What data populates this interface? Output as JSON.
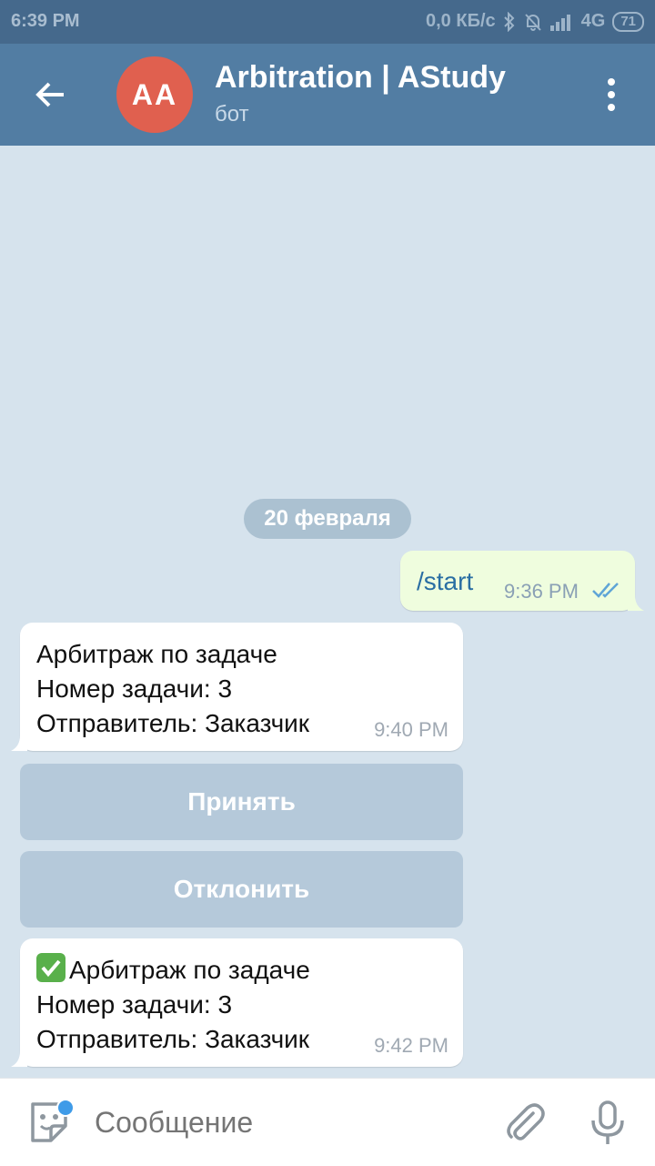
{
  "status_bar": {
    "time": "6:39 PM",
    "speed": "0,0 КБ/с",
    "network": "4G",
    "battery": "71"
  },
  "header": {
    "avatar_initials": "AA",
    "title": "Arbitration | AStudy",
    "subtitle": "бот",
    "icons": [
      "back-arrow-icon",
      "more-vertical-icon"
    ]
  },
  "chat": {
    "date_label": "20 февраля",
    "outgoing": {
      "text": "/start",
      "time": "9:36 PM",
      "status": "read"
    },
    "incoming_1": {
      "lines": [
        "Арбитраж по задаче",
        "Номер задачи: 3",
        "Отправитель: Заказчик"
      ],
      "time": "9:40 PM"
    },
    "buttons": {
      "accept": "Принять",
      "reject": "Отклонить"
    },
    "incoming_2": {
      "lines": [
        "Арбитраж по задаче",
        "Номер задачи: 3",
        "Отправитель: Заказчик"
      ],
      "time": "9:42 PM",
      "emoji": "check-mark-button"
    }
  },
  "input": {
    "placeholder": "Сообщение",
    "icons": [
      "sticker-icon",
      "attach-icon",
      "mic-icon"
    ]
  },
  "colors": {
    "header": "#527da3",
    "status_bar": "#45698c",
    "chat_bg": "#d6e3ed",
    "out_bubble": "#effdde",
    "avatar": "#e0604f",
    "keyboard_button": "#b5c9da"
  }
}
